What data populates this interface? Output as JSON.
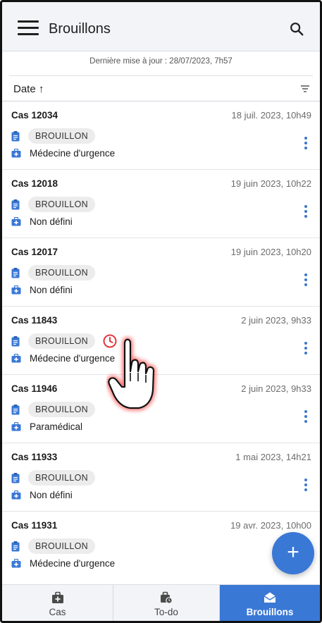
{
  "header": {
    "title": "Brouillons",
    "menu_icon": "hamburger-menu-icon",
    "search_icon": "search-icon"
  },
  "last_update": "Dernière mise à jour : 28/07/2023, 7h57",
  "sort": {
    "label": "Date ↑",
    "filter_icon": "filter-icon"
  },
  "items": [
    {
      "id": "Cas 12034",
      "date": "18 juil. 2023, 10h49",
      "status": "BROUILLON",
      "specialty": "Médecine d'urgence",
      "clock": false
    },
    {
      "id": "Cas 12018",
      "date": "19 juin 2023, 10h22",
      "status": "BROUILLON",
      "specialty": "Non défini",
      "clock": false
    },
    {
      "id": "Cas 12017",
      "date": "19 juin 2023, 10h20",
      "status": "BROUILLON",
      "specialty": "Non défini",
      "clock": false
    },
    {
      "id": "Cas 11843",
      "date": "2 juin 2023, 9h33",
      "status": "BROUILLON",
      "specialty": "Médecine d'urgence",
      "clock": true
    },
    {
      "id": "Cas 11946",
      "date": "2 juin 2023, 9h33",
      "status": "BROUILLON",
      "specialty": "Paramédical",
      "clock": false
    },
    {
      "id": "Cas 11933",
      "date": "1 mai 2023, 14h21",
      "status": "BROUILLON",
      "specialty": "Non défini",
      "clock": false
    },
    {
      "id": "Cas 11931",
      "date": "19 avr. 2023, 10h00",
      "status": "BROUILLON",
      "specialty": "Médecine d'urgence",
      "clock": false
    }
  ],
  "fab_label": "+",
  "bottom_nav": [
    {
      "label": "Cas",
      "icon": "medical-kit-icon",
      "active": false
    },
    {
      "label": "To-do",
      "icon": "kit-clock-icon",
      "active": false
    },
    {
      "label": "Brouillons",
      "icon": "envelope-open-icon",
      "active": true
    }
  ],
  "colors": {
    "accent": "#3a78d6",
    "header_bg": "#f2f4f7",
    "badge_bg": "#ececec",
    "alert": "#e0393e"
  }
}
